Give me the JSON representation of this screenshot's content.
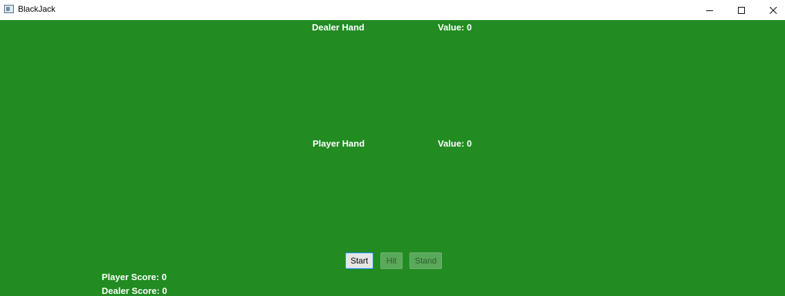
{
  "window": {
    "title": "BlackJack",
    "controls": {
      "minimize": "minimize-icon",
      "maximize": "maximize-icon",
      "close": "close-icon"
    }
  },
  "table": {
    "background": "#228b22",
    "dealer": {
      "label": "Dealer Hand",
      "value": "Value: 0"
    },
    "player": {
      "label": "Player Hand",
      "value": "Value: 0"
    }
  },
  "buttons": {
    "start": "Start",
    "hit": "Hit",
    "stand": "Stand"
  },
  "scores": {
    "player": "Player Score: 0",
    "dealer": "Dealer Score: 0"
  }
}
